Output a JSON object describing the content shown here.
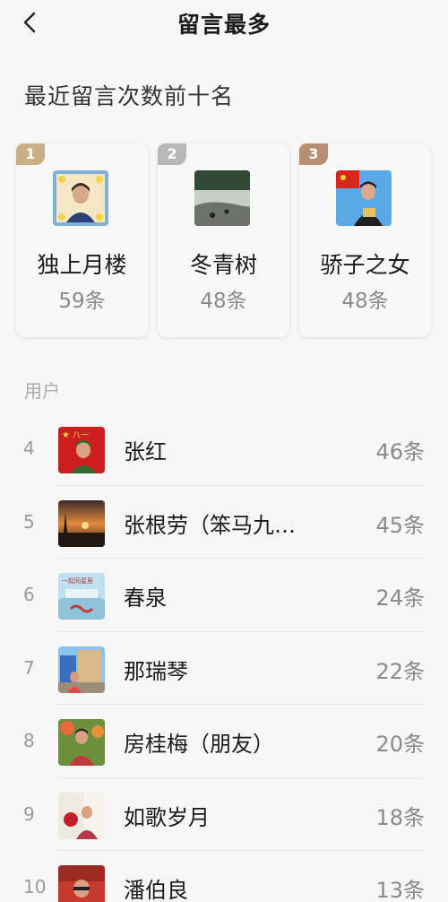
{
  "header": {
    "title": "留言最多"
  },
  "section_title": "最近留言次数前十名",
  "top3": [
    {
      "rank": "1",
      "name": "独上月楼",
      "count": "59条",
      "badge_color": "#c9ae86"
    },
    {
      "rank": "2",
      "name": "冬青树",
      "count": "48条",
      "badge_color": "#b8b8b8"
    },
    {
      "rank": "3",
      "name": "骄子之女",
      "count": "48条",
      "badge_color": "#b88f73"
    }
  ],
  "users_label": "用户",
  "list": [
    {
      "rank": "4",
      "name": "张红",
      "count": "46条"
    },
    {
      "rank": "5",
      "name": "张根劳（笨马九…",
      "count": "45条"
    },
    {
      "rank": "6",
      "name": "春泉",
      "count": "24条"
    },
    {
      "rank": "7",
      "name": "那瑞琴",
      "count": "22条"
    },
    {
      "rank": "8",
      "name": "房桂梅（朋友）",
      "count": "20条"
    },
    {
      "rank": "9",
      "name": "如歌岁月",
      "count": "18条"
    },
    {
      "rank": "10",
      "name": "潘伯良",
      "count": "13条"
    }
  ],
  "avatar_texts": {
    "zhanghong": "八一",
    "chunquan": "一起同星辰"
  }
}
